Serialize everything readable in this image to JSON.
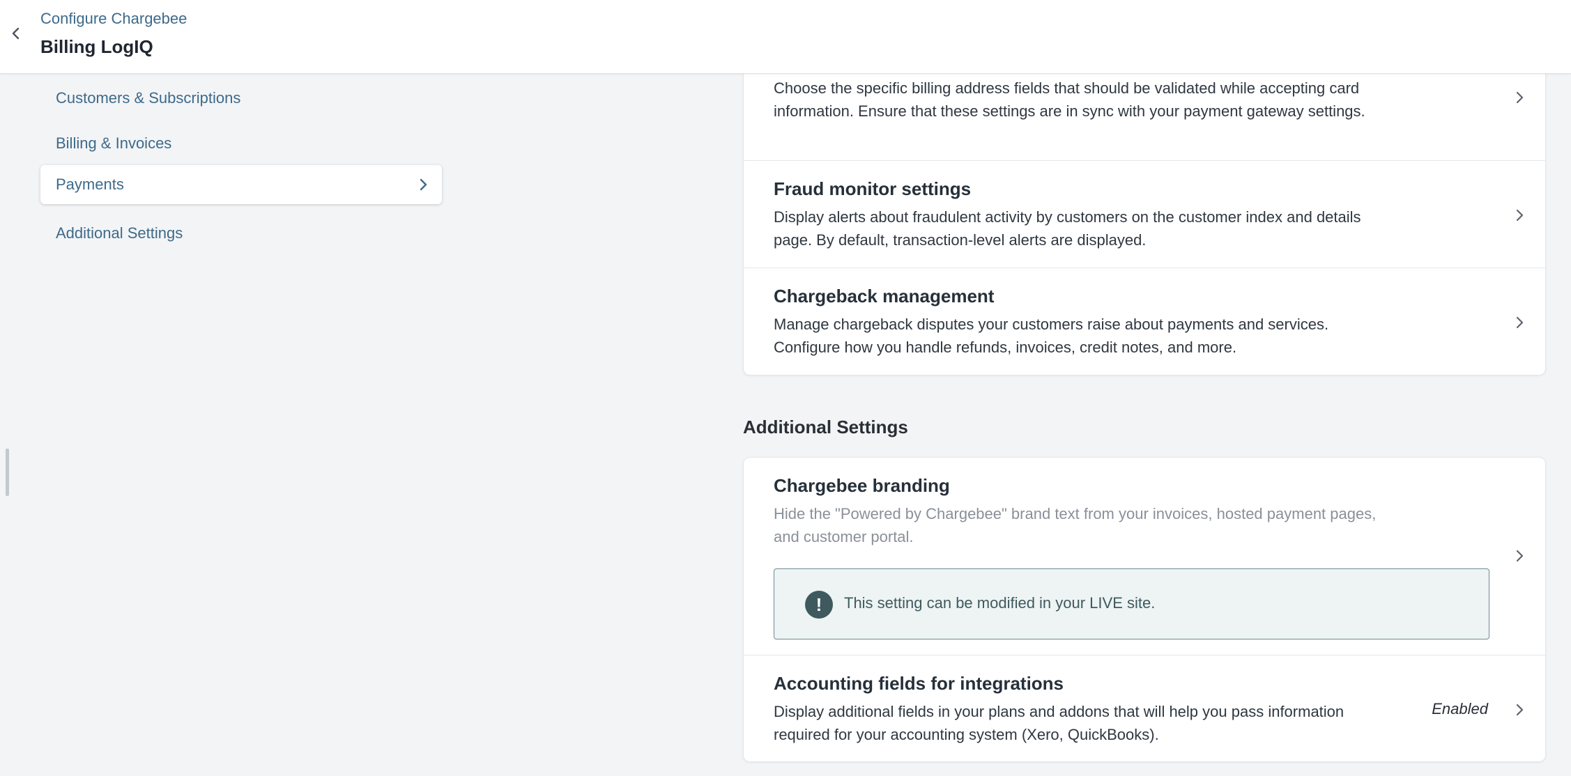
{
  "header": {
    "breadcrumb": "Configure Chargebee",
    "title": "Billing LogIQ"
  },
  "sidebar": {
    "items": [
      {
        "label": "Customers & Subscriptions"
      },
      {
        "label": "Billing & Invoices"
      },
      {
        "label": "Payments",
        "active": true
      },
      {
        "label": "Additional Settings"
      }
    ]
  },
  "payments_card": {
    "rows": [
      {
        "title": "",
        "description": "Choose the specific billing address fields that should be validated while accepting card information. Ensure that these settings are in sync with your payment gateway settings."
      },
      {
        "title": "Fraud monitor settings",
        "description": "Display alerts about fraudulent activity by customers on the customer index and details page. By default, transaction-level alerts are displayed."
      },
      {
        "title": "Chargeback management",
        "description": "Manage chargeback disputes your customers raise about payments and services. Configure how you handle refunds, invoices, credit notes, and more."
      }
    ]
  },
  "additional_settings": {
    "heading": "Additional Settings",
    "rows": [
      {
        "title": "Chargebee branding",
        "description": "Hide the \"Powered by Chargebee\" brand text from your invoices, hosted payment pages, and customer portal.",
        "notice": "This setting can be modified in your LIVE site.",
        "notice_icon": "!"
      },
      {
        "title": "Accounting fields for integrations",
        "description": "Display additional fields in your plans and addons that will help you pass information required for your accounting system (Xero, QuickBooks).",
        "status": "Enabled"
      }
    ]
  },
  "icons": {
    "back": "chevron-left-icon",
    "row_arrow": "chevron-right-icon",
    "notice": "exclamation-circle-icon"
  },
  "colors": {
    "link": "#3d6a8a",
    "background": "#f3f4f6",
    "notice_bg": "#eef3f3",
    "notice_icon": "#3e5a5f"
  }
}
